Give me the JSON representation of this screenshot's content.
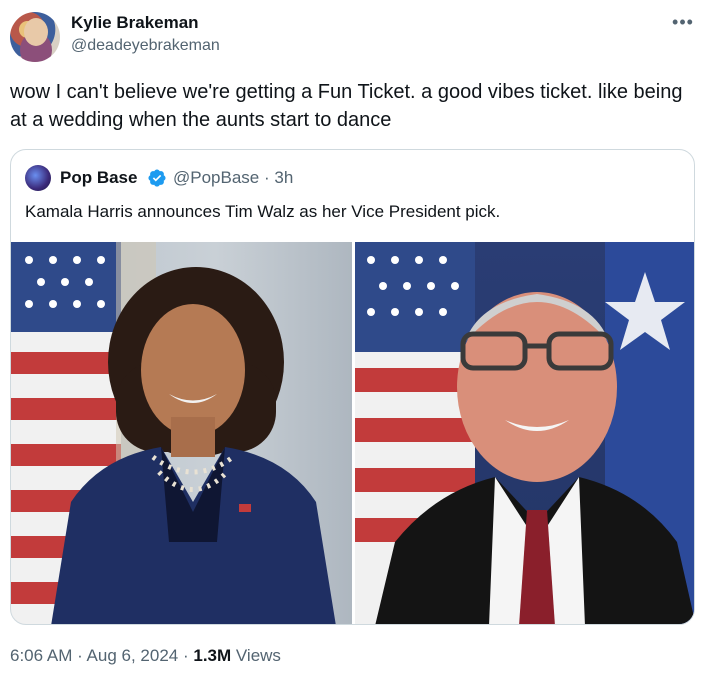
{
  "author": {
    "name": "Kylie Brakeman",
    "handle": "@deadeyebrakeman"
  },
  "tweet": {
    "text": "wow I can't believe we're getting a Fun Ticket. a good vibes ticket. like being at a wedding when the aunts start to dance"
  },
  "quote": {
    "name": "Pop Base",
    "handle_time": "@PopBase · 3h",
    "text": "Kamala Harris announces Tim Walz as her Vice President pick."
  },
  "meta": {
    "time": "6:06 AM",
    "sep1": " · ",
    "date": "Aug 6, 2024",
    "sep2": " · ",
    "views_count": "1.3M",
    "views_label": " Views"
  },
  "icons": {
    "more": "more-icon",
    "verified": "verified-icon",
    "accent": "#1d9bf0"
  }
}
